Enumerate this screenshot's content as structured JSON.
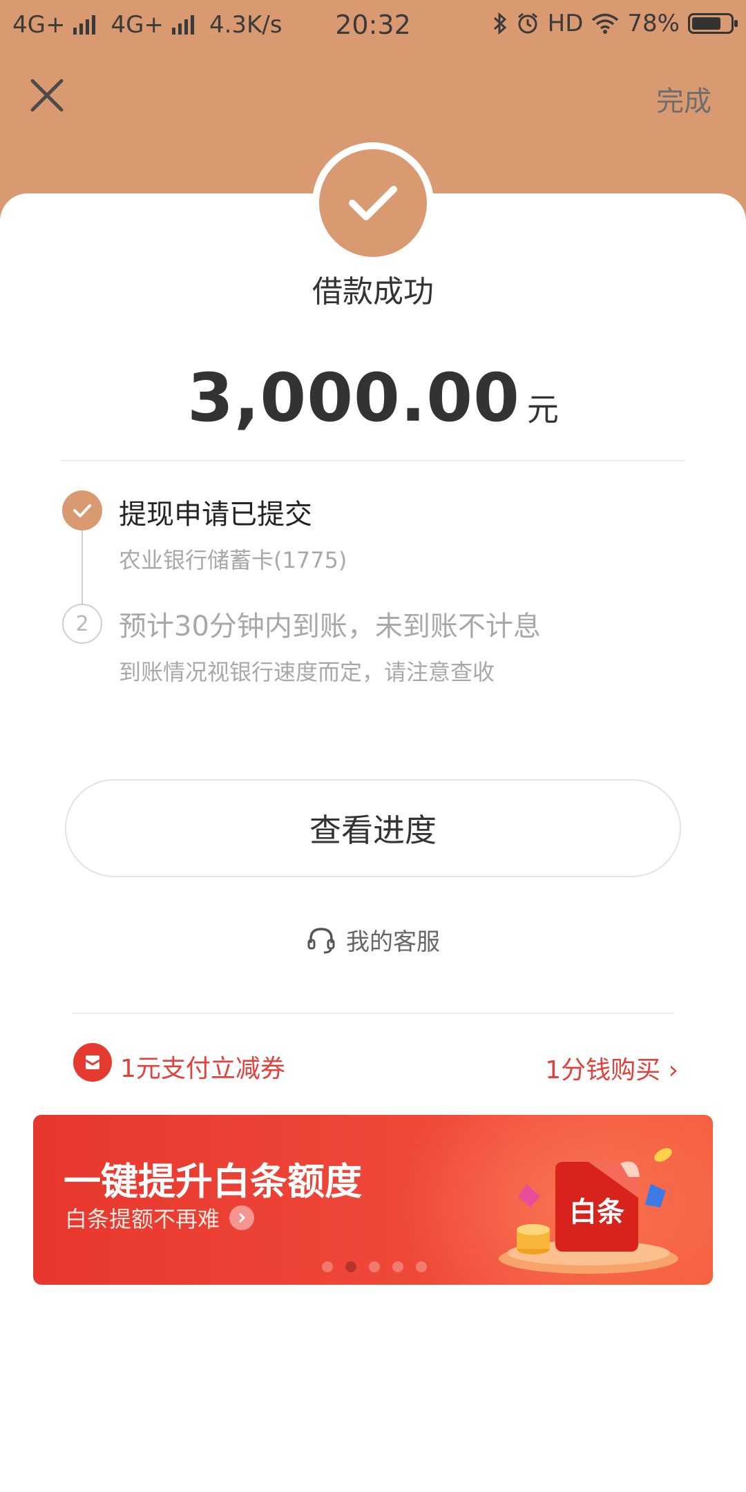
{
  "status_bar": {
    "network1": "4G+",
    "network2": "4G+",
    "speed": "4.3K/s",
    "time": "20:32",
    "hd": "HD",
    "battery": "78%",
    "battery_level": 0.78
  },
  "nav": {
    "close_icon": "close-icon",
    "done_label": "完成"
  },
  "result": {
    "title": "借款成功",
    "amount": "3,000.00",
    "unit": "元"
  },
  "steps": [
    {
      "index": "1",
      "title": "提现申请已提交",
      "subtitle": "农业银行储蓄卡(1775)",
      "done": true
    },
    {
      "index": "2",
      "title": "预计30分钟内到账，未到账不计息",
      "subtitle": "到账情况视银行速度而定，请注意查收",
      "done": false
    }
  ],
  "actions": {
    "progress_button": "查看进度",
    "service_label": "我的客服"
  },
  "coupon": {
    "text": "1元支付立减券",
    "buy_label": "1分钱购买",
    "chevron": "›"
  },
  "banner": {
    "title": "一键提升白条额度",
    "subtitle": "白条提额不再难",
    "badge_text": "白条",
    "active_dot": 2,
    "dot_count": 5
  },
  "colors": {
    "accent": "#d99a72",
    "red": "#e53a30"
  }
}
